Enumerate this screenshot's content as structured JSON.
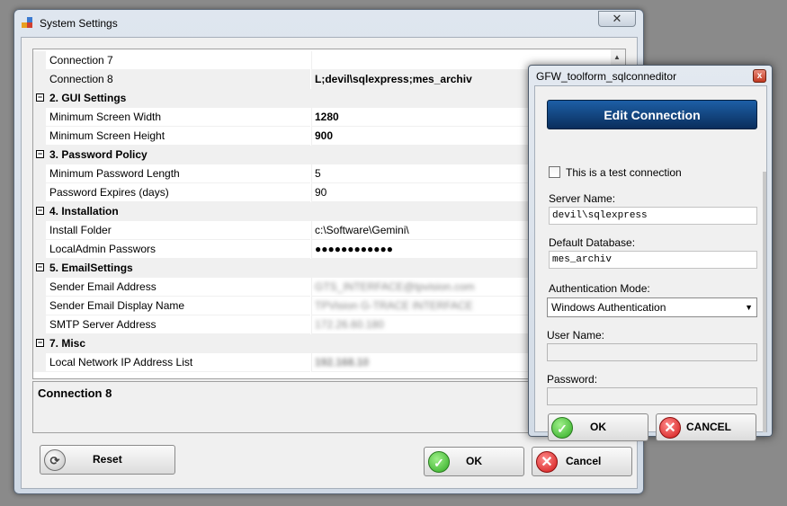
{
  "main_window": {
    "title": "System Settings",
    "close_glyph": "✕",
    "grid": {
      "rows": [
        {
          "type": "prop",
          "name": "Connection 7",
          "value": ""
        },
        {
          "type": "prop",
          "name": "Connection 8",
          "value": "L;devil\\sqlexpress;mes_archiv",
          "bold": true,
          "selected": true
        },
        {
          "type": "cat",
          "name": "2. GUI Settings"
        },
        {
          "type": "prop",
          "name": "Minimum Screen Width",
          "value": "1280",
          "bold": true
        },
        {
          "type": "prop",
          "name": "Minimum Screen Height",
          "value": "900",
          "bold": true
        },
        {
          "type": "cat",
          "name": "3. Password Policy"
        },
        {
          "type": "prop",
          "name": "Minimum Password Length",
          "value": "5"
        },
        {
          "type": "prop",
          "name": "Password Expires (days)",
          "value": "90"
        },
        {
          "type": "cat",
          "name": "4. Installation"
        },
        {
          "type": "prop",
          "name": "Install Folder",
          "value": "c:\\Software\\Gemini\\"
        },
        {
          "type": "prop",
          "name": "LocalAdmin Passwors",
          "value": "●●●●●●●●●●●●"
        },
        {
          "type": "cat",
          "name": "5. EmailSettings"
        },
        {
          "type": "prop",
          "name": "Sender Email Address",
          "value": "GTS_INTERFACE@tpvision.com",
          "blurred": true
        },
        {
          "type": "prop",
          "name": "Sender Email Display Name",
          "value": "TPVision G-TRACE INTERFACE",
          "blurred": true
        },
        {
          "type": "prop",
          "name": "SMTP Server Address",
          "value": "172.26.60.180",
          "blurred": true
        },
        {
          "type": "cat",
          "name": "7. Misc"
        },
        {
          "type": "prop",
          "name": "Local Network IP Address List",
          "value": "192.168.10",
          "blurred": true,
          "bold": true
        }
      ],
      "expander_glyph": "−",
      "scroll_up_glyph": "▲"
    },
    "description_title": "Connection 8",
    "buttons": {
      "reset": "Reset",
      "ok": "OK",
      "cancel": "Cancel"
    },
    "icons": {
      "reset": "refresh-icon",
      "ok": "check-icon",
      "cancel": "x-icon"
    }
  },
  "dialog": {
    "title": "GFW_toolform_sqlconneditor",
    "close_glyph": "x",
    "header": "Edit Connection",
    "test_connection_label": "This is a test connection",
    "server_name_label": "Server Name:",
    "server_name_value": "devil\\sqlexpress",
    "default_db_label": "Default Database:",
    "default_db_value": "mes_archiv",
    "auth_mode_label": "Authentication Mode:",
    "auth_mode_value": "Windows Authentication",
    "combo_arrow_glyph": "▼",
    "user_name_label": "User Name:",
    "user_name_value": "",
    "password_label": "Password:",
    "password_value": "",
    "buttons": {
      "ok": "OK",
      "cancel": "CANCEL"
    }
  },
  "glyphs": {
    "check": "✓",
    "cross": "✕",
    "refresh": "⟳"
  },
  "colors": {
    "header_bar": "#0f3d75",
    "ok_green": "#2faa22",
    "cancel_red": "#d21616"
  }
}
